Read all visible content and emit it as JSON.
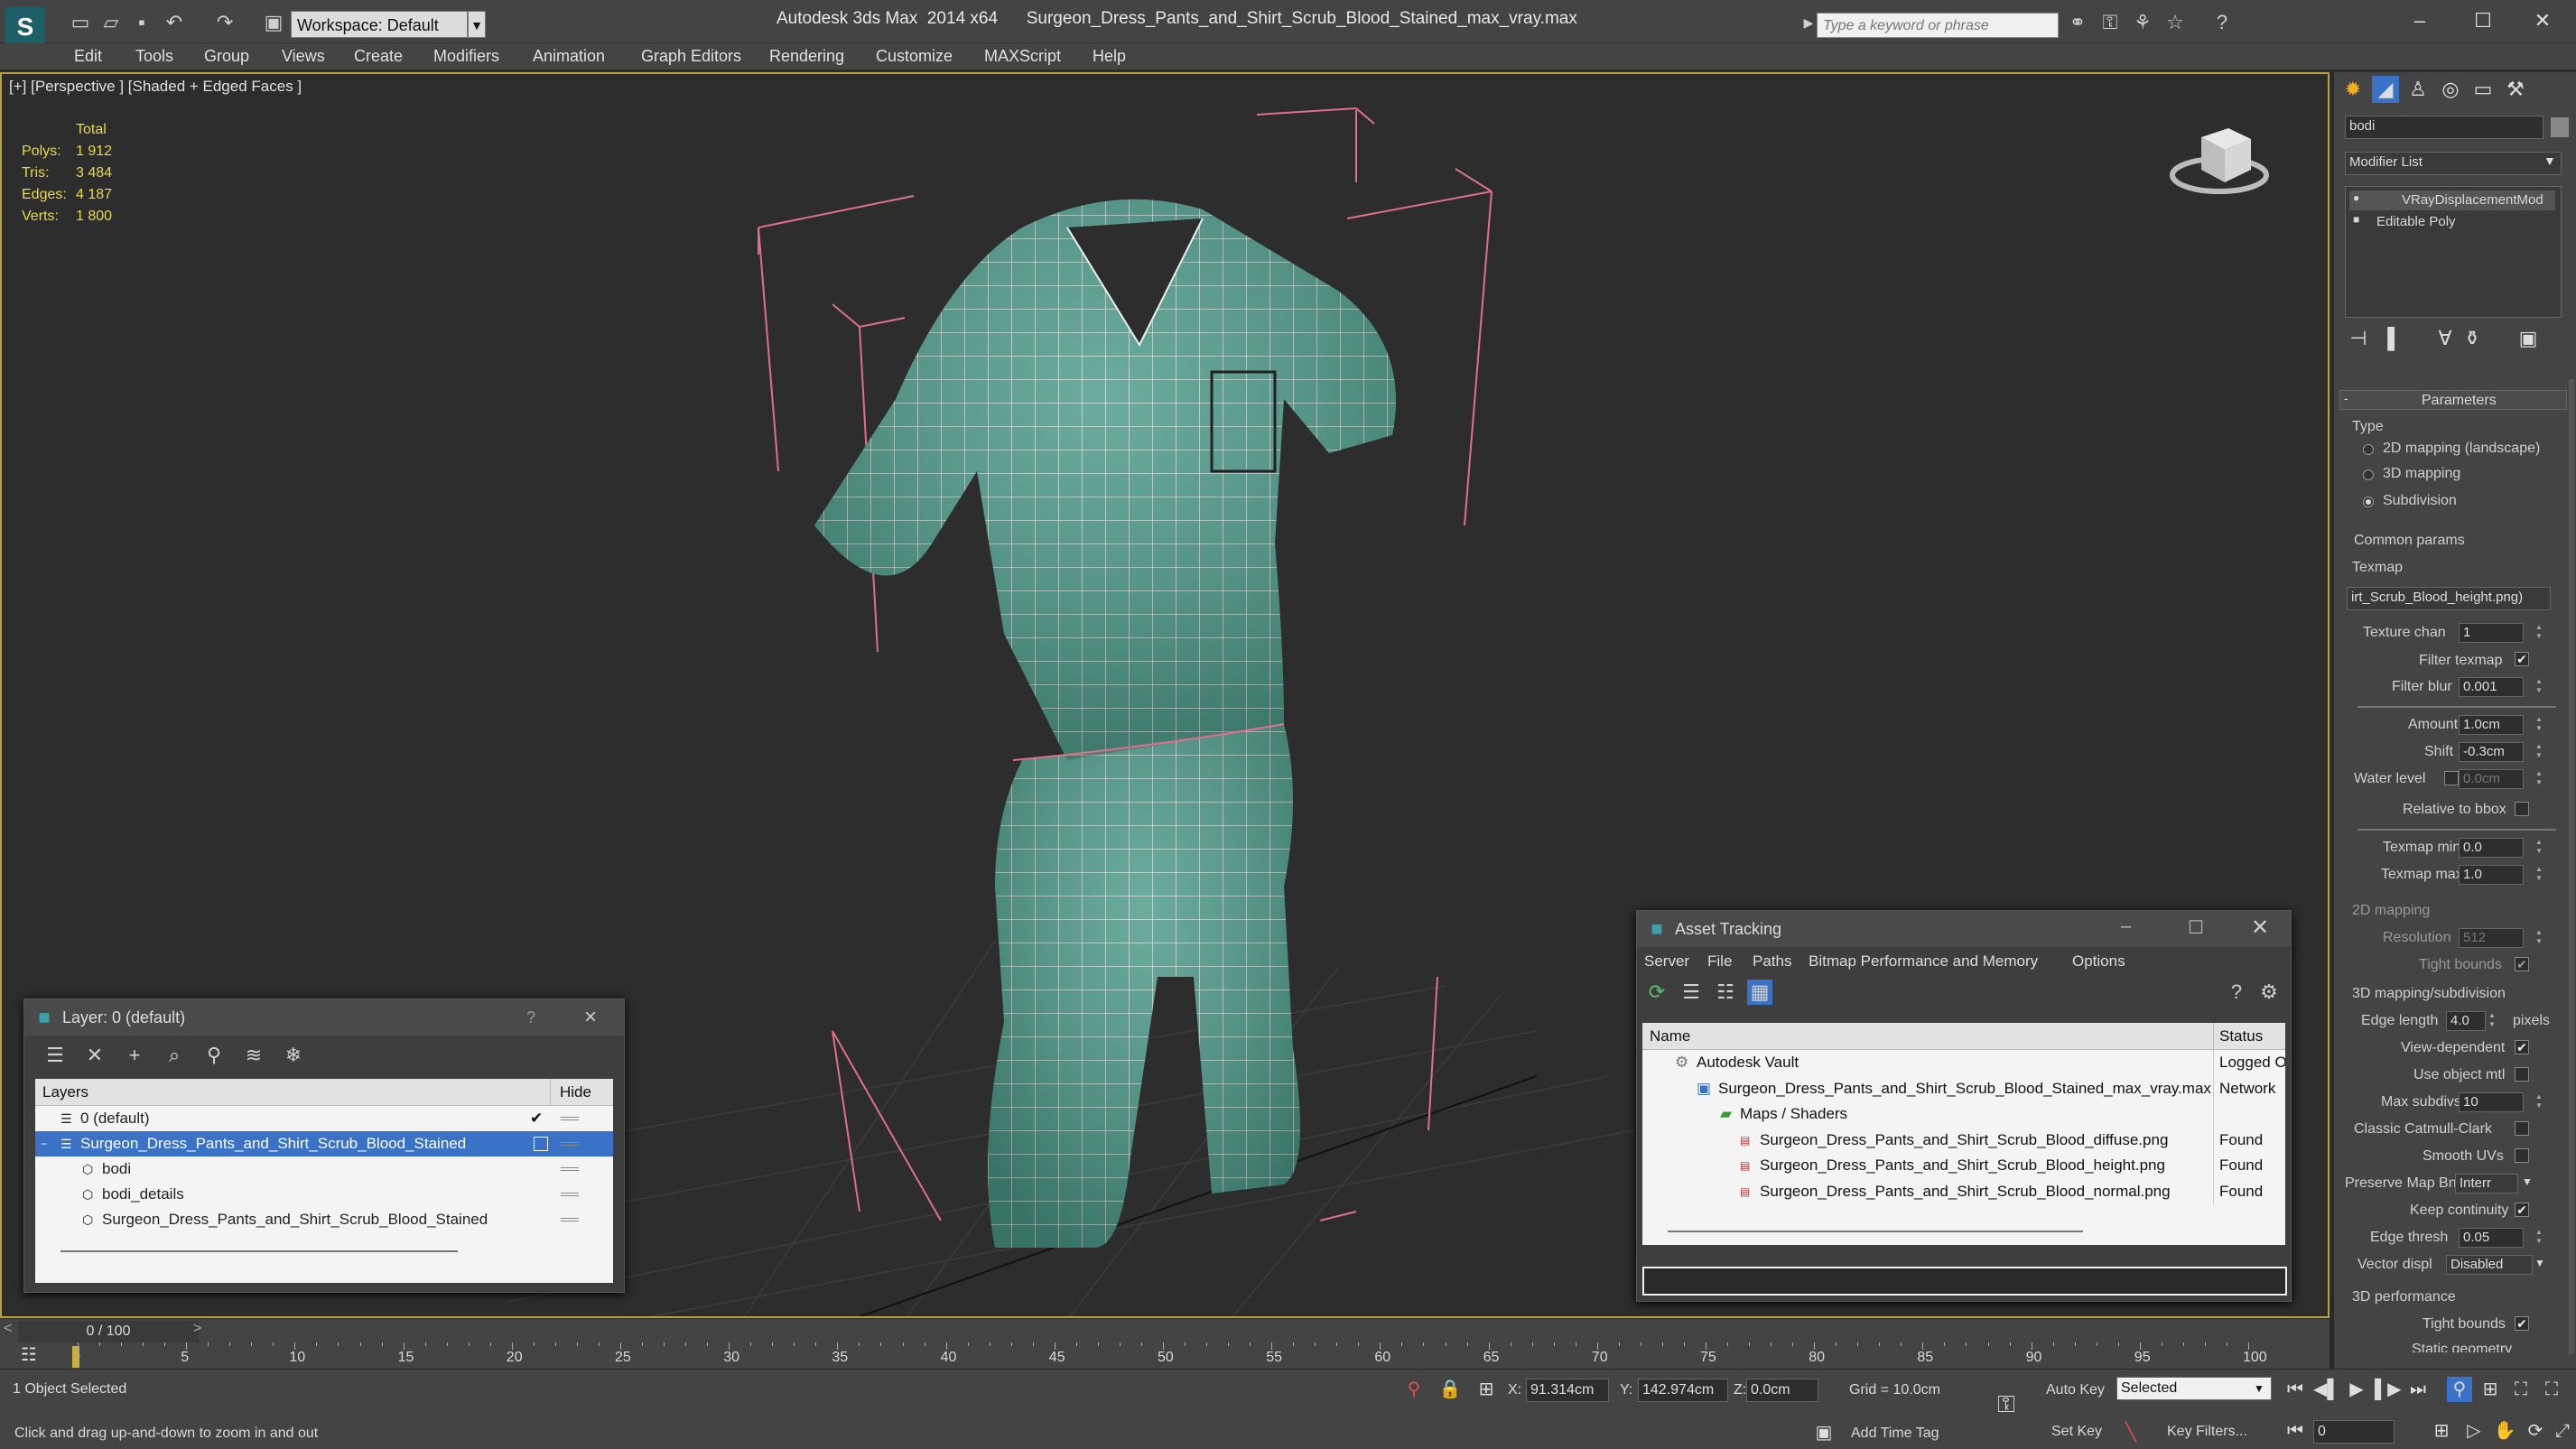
{
  "app": {
    "title": "Autodesk 3ds Max  2014 x64      Surgeon_Dress_Pants_and_Shirt_Scrub_Blood_Stained_max_vray.max",
    "workspace": "Workspace: Default",
    "search_placeholder": "Type a keyword or phrase"
  },
  "menu": [
    "Edit",
    "Tools",
    "Group",
    "Views",
    "Create",
    "Modifiers",
    "Animation",
    "Graph Editors",
    "Rendering",
    "Customize",
    "MAXScript",
    "Help"
  ],
  "viewport": {
    "label": "[+] [Perspective ] [Shaded + Edged Faces ]",
    "stats": {
      "header": "Total",
      "rows": [
        {
          "k": "Polys:",
          "v": "1 912"
        },
        {
          "k": "Tris:",
          "v": "3 484"
        },
        {
          "k": "Edges:",
          "v": "4 187"
        },
        {
          "k": "Verts:",
          "v": "1 800"
        }
      ]
    }
  },
  "layer_window": {
    "title": "Layer: 0 (default)",
    "help": "?",
    "close": "×",
    "col_layers": "Layers",
    "col_hide": "Hide",
    "rows": [
      {
        "label": "0 (default)"
      },
      {
        "label": "Surgeon_Dress_Pants_and_Shirt_Scrub_Blood_Stained"
      },
      {
        "label": "bodi"
      },
      {
        "label": "bodi_details"
      },
      {
        "label": "Surgeon_Dress_Pants_and_Shirt_Scrub_Blood_Stained"
      }
    ]
  },
  "asset_window": {
    "title": "Asset Tracking",
    "menu": [
      "Server",
      "File",
      "Paths",
      "Bitmap Performance and Memory",
      "Options"
    ],
    "col_name": "Name",
    "col_status": "Status",
    "rows": [
      {
        "name": "Autodesk Vault",
        "status": "Logged O"
      },
      {
        "name": "Surgeon_Dress_Pants_and_Shirt_Scrub_Blood_Stained_max_vray.max",
        "status": "Network"
      },
      {
        "name": "Maps / Shaders",
        "status": ""
      },
      {
        "name": "Surgeon_Dress_Pants_and_Shirt_Scrub_Blood_diffuse.png",
        "status": "Found"
      },
      {
        "name": "Surgeon_Dress_Pants_and_Shirt_Scrub_Blood_height.png",
        "status": "Found"
      },
      {
        "name": "Surgeon_Dress_Pants_and_Shirt_Scrub_Blood_normal.png",
        "status": "Found"
      }
    ]
  },
  "command_panel": {
    "object_name": "bodi",
    "modifier_list": "Modifier List",
    "stack": [
      "VRayDisplacementMod",
      "Editable Poly"
    ],
    "params_title": "Parameters",
    "type_label": "Type",
    "type_options": [
      "2D mapping (landscape)",
      "3D mapping",
      "Subdivision"
    ],
    "common_params": "Common params",
    "texmap_label": "Texmap",
    "texmap_value": "irt_Scrub_Blood_height.png)",
    "texture_chan_label": "Texture chan",
    "texture_chan": "1",
    "filter_texmap_label": "Filter texmap",
    "filter_blur_label": "Filter blur",
    "filter_blur": "0.001",
    "amount_label": "Amount",
    "amount": "1.0cm",
    "shift_label": "Shift",
    "shift": "-0.3cm",
    "water_level_label": "Water level",
    "water_level": "0.0cm",
    "relative_bbox_label": "Relative to bbox",
    "texmap_min_label": "Texmap min",
    "texmap_min": "0.0",
    "texmap_max_label": "Texmap max",
    "texmap_max": "1.0",
    "mapping2d": "2D mapping",
    "resolution_label": "Resolution",
    "resolution": "512",
    "tight_bounds_label": "Tight bounds",
    "mapping3d": "3D mapping/subdivision",
    "edge_length_label": "Edge length",
    "edge_length": "4.0",
    "pixels_label": "pixels",
    "view_dependent_label": "View-dependent",
    "use_object_mtl_label": "Use object mtl",
    "max_subdivs_label": "Max subdivs",
    "max_subdivs": "10",
    "classic_catmull_label": "Classic Catmull-Clark",
    "smooth_uvs_label": "Smooth UVs",
    "preserve_map_label": "Preserve Map Bnd",
    "preserve_map_value": "Interr",
    "keep_continuity_label": "Keep continuity",
    "edge_thresh_label": "Edge thresh",
    "edge_thresh": "0.05",
    "vector_displ_label": "Vector displ",
    "vector_displ_value": "Disabled",
    "perf_title": "3D performance",
    "tight_bounds2_label": "Tight bounds",
    "static_geometry_label": "Static geometry"
  },
  "timeline": {
    "frame": "0 / 100",
    "ticks": [
      "0",
      "5",
      "10",
      "15",
      "20",
      "25",
      "30",
      "35",
      "40",
      "45",
      "50",
      "55",
      "60",
      "65",
      "70",
      "75",
      "80",
      "85",
      "90",
      "95",
      "100"
    ]
  },
  "status": {
    "selection": "1 Object Selected",
    "prompt": "Click and drag up-and-down to zoom in and out",
    "x_label": "X:",
    "x": "91.314cm",
    "y_label": "Y:",
    "y": "142.974cm",
    "z_label": "Z:",
    "z": "0.0cm",
    "grid": "Grid = 10.0cm",
    "add_time_tag": "Add Time Tag",
    "auto_key": "Auto Key",
    "selected": "Selected",
    "set_key": "Set Key",
    "key_filters": "Key Filters...",
    "frame_field": "0"
  }
}
